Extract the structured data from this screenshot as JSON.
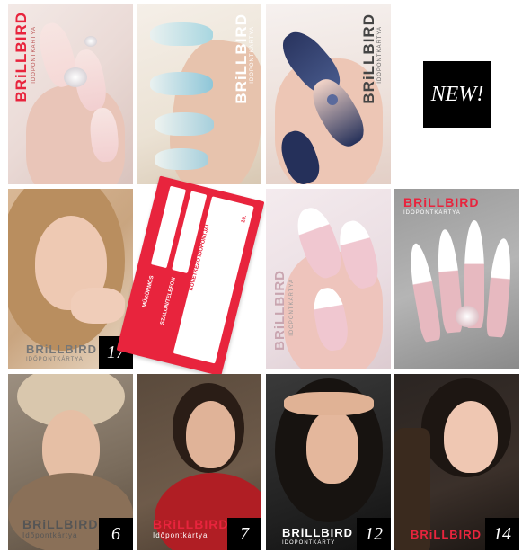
{
  "brand": {
    "name": "BRiLLBIRD",
    "subtitle": "IDŐPONTKÁRTYA"
  },
  "badge_new": "NEW!",
  "tiles": [
    {
      "id": "t1",
      "brand_text": "BRiLLBIRD",
      "sub_text": "IDŐPONTKÁRTYA",
      "number": ""
    },
    {
      "id": "t2",
      "brand_text": "BRiLLBIRD",
      "sub_text": "IDŐPONTKÁRTYA",
      "number": ""
    },
    {
      "id": "t3",
      "brand_text": "BRiLLBIRD",
      "sub_text": "IDŐPONTKÁRTYA",
      "number": ""
    },
    {
      "id": "t4",
      "brand_text": "BRiLLBIRD",
      "sub_text": "IDŐPONTKÁRTYA",
      "number": "17"
    },
    {
      "id": "t5",
      "card_top": "SZALON/TELEFON",
      "card_mid": "KÖVETKEZŐ IDŐPONTJAI",
      "card_name": "MŰKÖRMÖS",
      "card_num": "10."
    },
    {
      "id": "t6",
      "brand_text": "BRiLLBIRD",
      "sub_text": "IDŐPONTKÁRTYA",
      "number": ""
    },
    {
      "id": "t7",
      "brand_text": "BRiLLBIRD",
      "sub_text": "IDŐPONTKÁRTYA",
      "number": ""
    },
    {
      "id": "t8",
      "brand_text": "BRiLLBIRD",
      "sub_text": "Időpontkártya",
      "number": "6"
    },
    {
      "id": "t9",
      "brand_text": "BRiLLBIRD",
      "sub_text": "Időpontkártya",
      "number": "7"
    },
    {
      "id": "t10",
      "brand_text": "BRiLLBIRD",
      "sub_text": "IDŐPONTKÁRTY",
      "number": "12"
    },
    {
      "id": "t11",
      "brand_text": "BRiLLBIRD",
      "sub_text": "",
      "number": "14"
    }
  ],
  "colors": {
    "brand_red": "#e8243d",
    "badge_black": "#000000",
    "badge_text": "#ffffff"
  }
}
